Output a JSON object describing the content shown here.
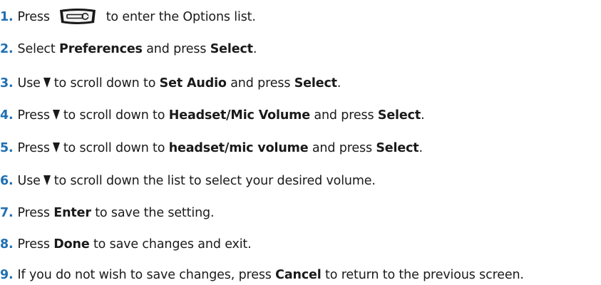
{
  "steps": [
    {
      "num": "1.",
      "a": "Press",
      "b": "to enter the Options list.",
      "icon": "options-key-icon"
    },
    {
      "num": "2.",
      "a": "Select ",
      "b1": "Preferences",
      "c": " and press ",
      "b2": "Select",
      "d": "."
    },
    {
      "num": "3.",
      "a": "Use",
      "c": "to scroll down to ",
      "b1": "Set Audio",
      "d": " and press ",
      "b2": "Select",
      "e": ".",
      "icon": "down-arrow-icon"
    },
    {
      "num": "4.",
      "a": "Press",
      "c": "to scroll down to ",
      "b1": "Headset/Mic Volume",
      "d": " and press ",
      "b2": "Select",
      "e": ".",
      "icon": "down-arrow-icon"
    },
    {
      "num": "5.",
      "a": "Press",
      "c": "to scroll down to ",
      "b1": "headset/mic volume",
      "d": " and press ",
      "b2": "Select",
      "e": ".",
      "icon": "down-arrow-icon"
    },
    {
      "num": "6.",
      "a": "Use",
      "c": "to scroll down the list to select your desired volume.",
      "icon": "down-arrow-icon"
    },
    {
      "num": "7.",
      "a": "Press ",
      "b1": "Enter",
      "c": " to save the setting."
    },
    {
      "num": "8.",
      "a": "Press ",
      "b1": "Done",
      "c": " to save changes and exit."
    },
    {
      "num": "9.",
      "a": "If you do not wish to save changes, press ",
      "b1": "Cancel",
      "c": " to return to the previous screen."
    }
  ],
  "colors": {
    "step_number": "#1f6fb2",
    "text": "#1a1a1a"
  }
}
